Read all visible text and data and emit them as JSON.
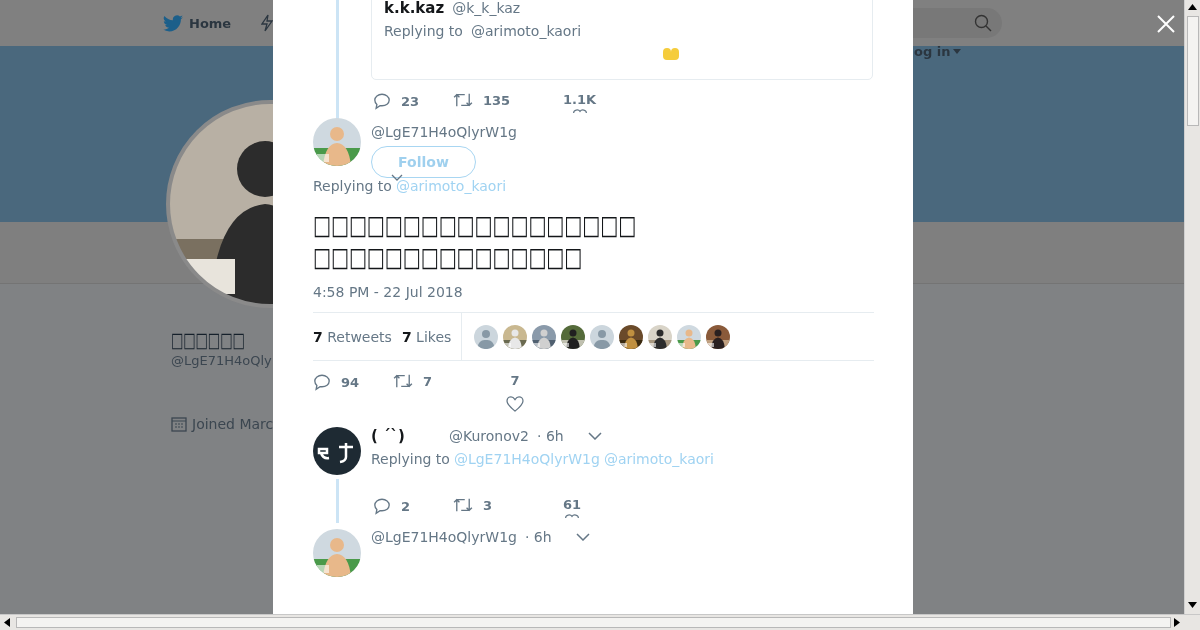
{
  "background": {
    "nav": {
      "home": "Home"
    },
    "login": "og in",
    "profile": {
      "name": "□□□□□□",
      "handle": "@LgE71H4oQly",
      "joined": "Joined Marc"
    }
  },
  "modal": {
    "quoted": {
      "name": "k.k.kaz",
      "handle": "@k_k_kaz",
      "replying_label": "Replying to",
      "replying_to": "@arimoto_kaori"
    },
    "quoted_actions": {
      "replies": "23",
      "retweets": "135",
      "likes": "1.1K"
    },
    "tweet": {
      "handle": "@LgE71H4oQlyrW1g",
      "follow": "Follow",
      "replying_label": "Replying to",
      "replying_to": "@arimoto_kaori",
      "lines": [
        "□□□□□□□□□□□□□□□□□□",
        "□□□□□□□□□□□□□□□"
      ],
      "time": "4:58 PM - 22 Jul 2018",
      "retweets_count": "7",
      "retweets_label": "Retweets",
      "likes_count": "7",
      "likes_label": "Likes",
      "likers": [
        {
          "kind": "default"
        },
        {
          "kind": "picture"
        },
        {
          "kind": "picture"
        },
        {
          "kind": "picture"
        },
        {
          "kind": "default"
        },
        {
          "kind": "picture"
        },
        {
          "kind": "picture"
        },
        {
          "kind": "picture"
        },
        {
          "kind": "picture"
        }
      ],
      "actions": {
        "replies": "94",
        "retweets": "7",
        "likes": "7"
      }
    },
    "replies": [
      {
        "name": "( ´`)",
        "handle": "@Kuronov2",
        "time": "· 6h",
        "replying_label": "Replying to",
        "replying_to": [
          "@LgE71H4oQlyrW1g",
          "@arimoto_kaori"
        ],
        "actions": {
          "replies": "2",
          "retweets": "3",
          "likes": "61"
        }
      },
      {
        "handle": "@LgE71H4oQlyrW1g",
        "time": "· 6h"
      }
    ]
  }
}
